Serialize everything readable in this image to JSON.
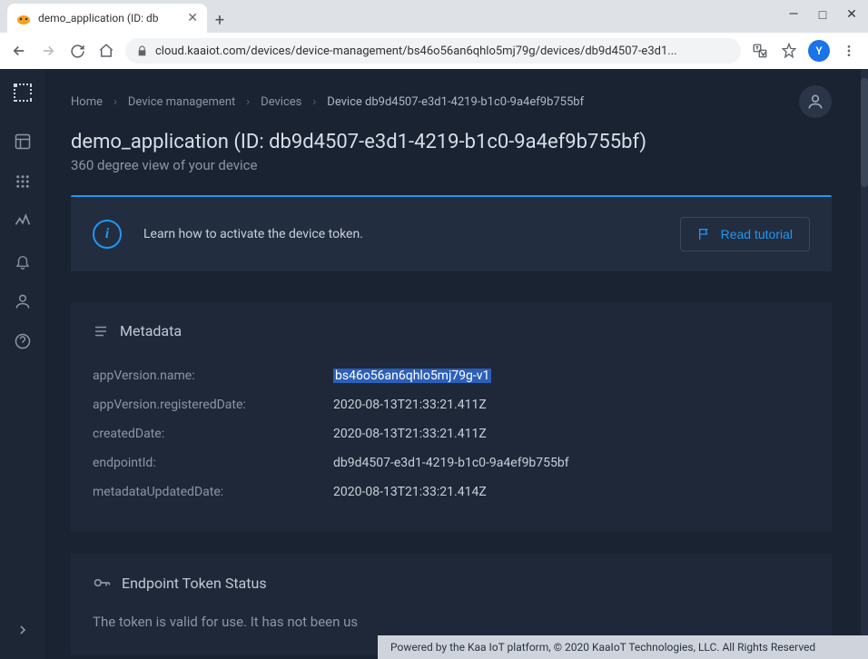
{
  "browser": {
    "tab_title": "demo_application (ID: db",
    "url": "cloud.kaaiot.com/devices/device-management/bs46o56an6qhlo5mj79g/devices/db9d4507-e3d1...",
    "avatar": "Y"
  },
  "breadcrumbs": {
    "items": [
      "Home",
      "Device management",
      "Devices"
    ],
    "current": "Device db9d4507-e3d1-4219-b1c0-9a4ef9b755bf"
  },
  "page": {
    "title": "demo_application (ID: db9d4507-e3d1-4219-b1c0-9a4ef9b755bf)",
    "subtitle": "360 degree view of your device"
  },
  "info": {
    "text": "Learn how to activate the device token.",
    "button": "Read tutorial"
  },
  "metadata": {
    "title": "Metadata",
    "rows": [
      {
        "key": "appVersion.name:",
        "val": "bs46o56an6qhlo5mj79g-v1",
        "highlighted": true
      },
      {
        "key": "appVersion.registeredDate:",
        "val": "2020-08-13T21:33:21.411Z"
      },
      {
        "key": "createdDate:",
        "val": "2020-08-13T21:33:21.411Z"
      },
      {
        "key": "endpointId:",
        "val": "db9d4507-e3d1-4219-b1c0-9a4ef9b755bf"
      },
      {
        "key": "metadataUpdatedDate:",
        "val": "2020-08-13T21:33:21.414Z"
      }
    ]
  },
  "endpoint": {
    "title": "Endpoint Token Status",
    "text": "The token is valid for use. It has not been us"
  },
  "footer": "Powered by the Kaa IoT platform, © 2020 KaaIoT Technologies, LLC. All Rights Reserved"
}
